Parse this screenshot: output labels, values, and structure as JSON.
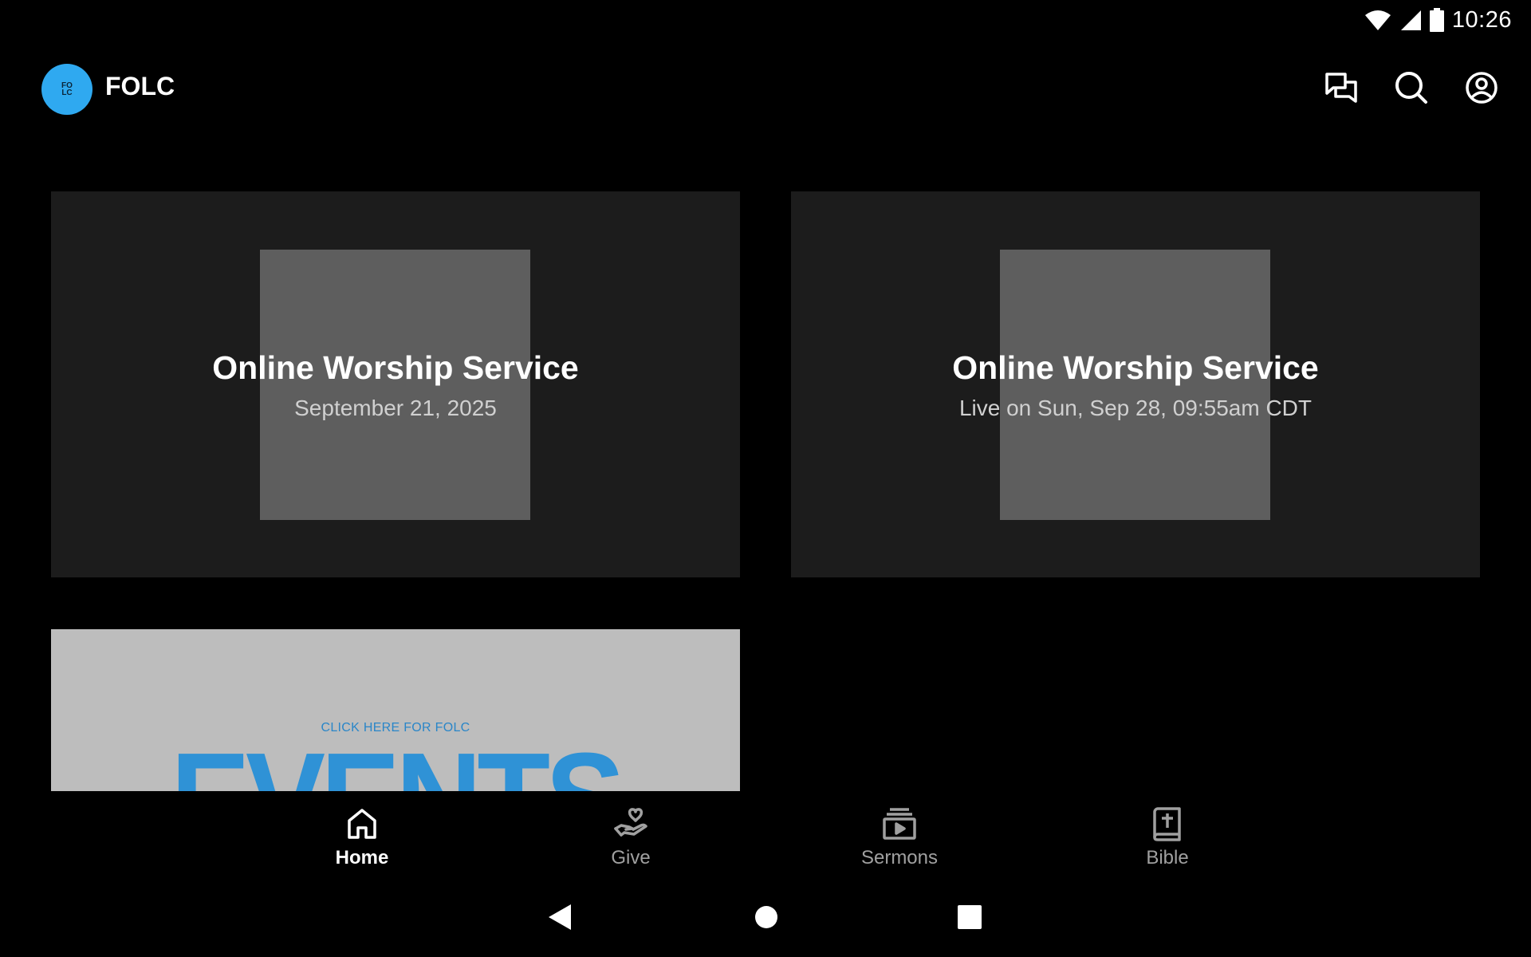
{
  "status": {
    "time": "10:26"
  },
  "app": {
    "title": "FOLC",
    "logo_text": "FOLC"
  },
  "cards": [
    {
      "title": "Online Worship Service",
      "subtitle": "September 21, 2025"
    },
    {
      "title": "Online Worship Service",
      "subtitle": "Live on Sun, Sep 28, 09:55am CDT"
    }
  ],
  "banner": {
    "small_text": "CLICK HERE FOR FOLC",
    "big_text": "EVENTS"
  },
  "nav": {
    "items": [
      {
        "label": "Home",
        "icon": "home-icon",
        "active": true
      },
      {
        "label": "Give",
        "icon": "give-icon",
        "active": false
      },
      {
        "label": "Sermons",
        "icon": "sermons-icon",
        "active": false
      },
      {
        "label": "Bible",
        "icon": "bible-icon",
        "active": false
      }
    ]
  },
  "colors": {
    "accent": "#2fa9f0",
    "card_bg": "#1c1c1c",
    "thumb": "#5e5e5e",
    "events_blue": "#2f92d6"
  }
}
